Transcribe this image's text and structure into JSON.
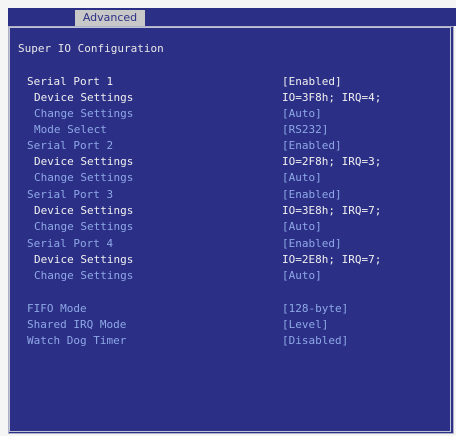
{
  "header": {
    "active_tab": "Advanced"
  },
  "page_title": "Super IO Configuration",
  "rows": [
    {
      "label": "Serial Port 1",
      "value": "[Enabled]",
      "label_color": "white",
      "value_color": "white",
      "indent": 0
    },
    {
      "label": "Device Settings",
      "value": "IO=3F8h; IRQ=4;",
      "label_color": "white",
      "value_color": "white",
      "indent": 1
    },
    {
      "label": "Change Settings",
      "value": "[Auto]",
      "label_color": "blue",
      "value_color": "blue",
      "indent": 1
    },
    {
      "label": "Mode Select",
      "value": "[RS232]",
      "label_color": "blue",
      "value_color": "blue",
      "indent": 1
    },
    {
      "label": "Serial Port 2",
      "value": "[Enabled]",
      "label_color": "blue",
      "value_color": "blue",
      "indent": 0
    },
    {
      "label": "Device Settings",
      "value": "IO=2F8h; IRQ=3;",
      "label_color": "white",
      "value_color": "white",
      "indent": 1
    },
    {
      "label": "Change Settings",
      "value": "[Auto]",
      "label_color": "blue",
      "value_color": "blue",
      "indent": 1
    },
    {
      "label": "Serial Port 3",
      "value": "[Enabled]",
      "label_color": "blue",
      "value_color": "blue",
      "indent": 0
    },
    {
      "label": "Device Settings",
      "value": "IO=3E8h; IRQ=7;",
      "label_color": "white",
      "value_color": "white",
      "indent": 1
    },
    {
      "label": "Change Settings",
      "value": "[Auto]",
      "label_color": "blue",
      "value_color": "blue",
      "indent": 1
    },
    {
      "label": "Serial Port 4",
      "value": "[Enabled]",
      "label_color": "blue",
      "value_color": "blue",
      "indent": 0
    },
    {
      "label": "Device Settings",
      "value": "IO=2E8h; IRQ=7;",
      "label_color": "white",
      "value_color": "white",
      "indent": 1
    },
    {
      "label": "Change Settings",
      "value": "[Auto]",
      "label_color": "blue",
      "value_color": "blue",
      "indent": 1
    },
    {
      "label": "FIFO Mode",
      "value": "[128-byte]",
      "label_color": "blue",
      "value_color": "blue",
      "indent": 0
    },
    {
      "label": "Shared IRQ Mode",
      "value": "[Level]",
      "label_color": "blue",
      "value_color": "blue",
      "indent": 0
    },
    {
      "label": "Watch Dog Timer",
      "value": "[Disabled]",
      "label_color": "blue",
      "value_color": "blue",
      "indent": 0
    }
  ],
  "colors": {
    "background": "#2b2f86",
    "text_white": "#f0f0f0",
    "text_blue": "#8ea8e6",
    "tab_bg": "#c8c8c8"
  }
}
